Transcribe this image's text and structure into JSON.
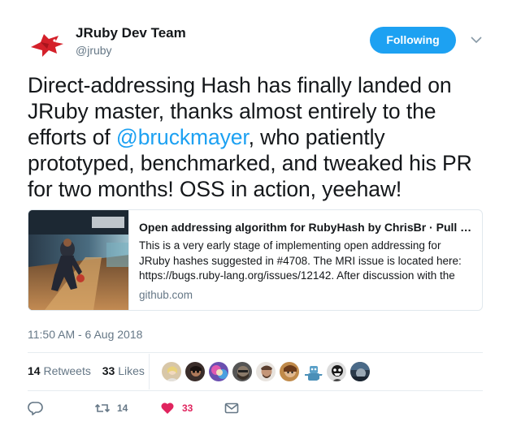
{
  "author": {
    "name": "JRuby Dev Team",
    "handle": "@jruby",
    "avatar_icon": "red-bird-logo"
  },
  "follow_button": {
    "label": "Following"
  },
  "tweet": {
    "text_before": "Direct-addressing Hash has finally landed on JRuby master, thanks almost entirely to the efforts of ",
    "mention": "@bruckmayer",
    "text_after": ", who patiently prototyped, benchmarked, and tweaked his PR for two months! OSS in action, yeehaw!"
  },
  "card": {
    "title": "Open addressing algorithm for RubyHash by ChrisBr · Pull Request",
    "description": "This is a very early stage of implementing open addressing for JRuby hashes suggested in #4708. The MRI issue is located here: https://bugs.ruby-lang.org/issues/12142. After discussion with the team",
    "domain": "github.com",
    "image_icon": "bowling-photo"
  },
  "timestamp": "11:50 AM - 6 Aug 2018",
  "stats": {
    "retweets_count": "14",
    "retweets_label": "Retweets",
    "likes_count": "33",
    "likes_label": "Likes"
  },
  "actions": {
    "reply_icon": "reply-icon",
    "retweet_count": "14",
    "like_count": "33",
    "dm_icon": "envelope-icon"
  },
  "colors": {
    "accent": "#1da1f2",
    "like": "#e0245e",
    "retweet": "#657786",
    "muted": "#657786"
  }
}
